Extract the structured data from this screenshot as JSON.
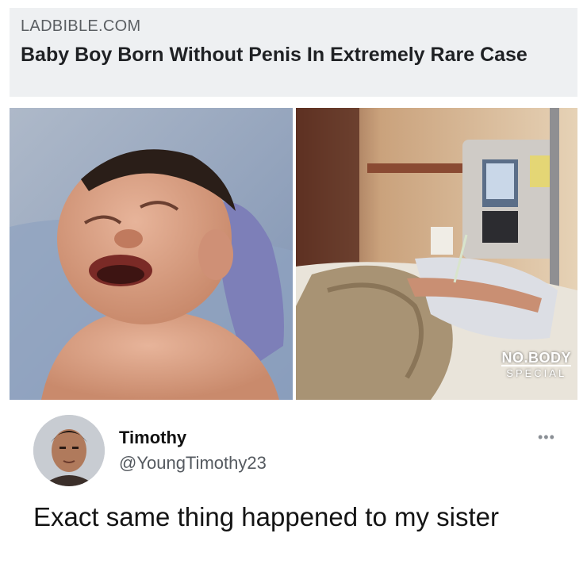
{
  "link_card": {
    "source": "LADBIBLE.COM",
    "headline": "Baby Boy Born Without Penis In Extremely Rare Case"
  },
  "photos": {
    "left_image": "newborn-baby-photo",
    "right_image": "hospital-bed-iv-photo",
    "watermark_top": "NO.BODY",
    "watermark_bottom": "SPECIAL"
  },
  "tweet": {
    "name": "Timothy",
    "handle": "@YoungTimothy23",
    "more_glyph": "•••",
    "text": "Exact same thing happened to my sister"
  },
  "colors": {
    "card_background": "#eef0f2",
    "handle_gray": "#555a60",
    "text_dark": "#141414"
  }
}
